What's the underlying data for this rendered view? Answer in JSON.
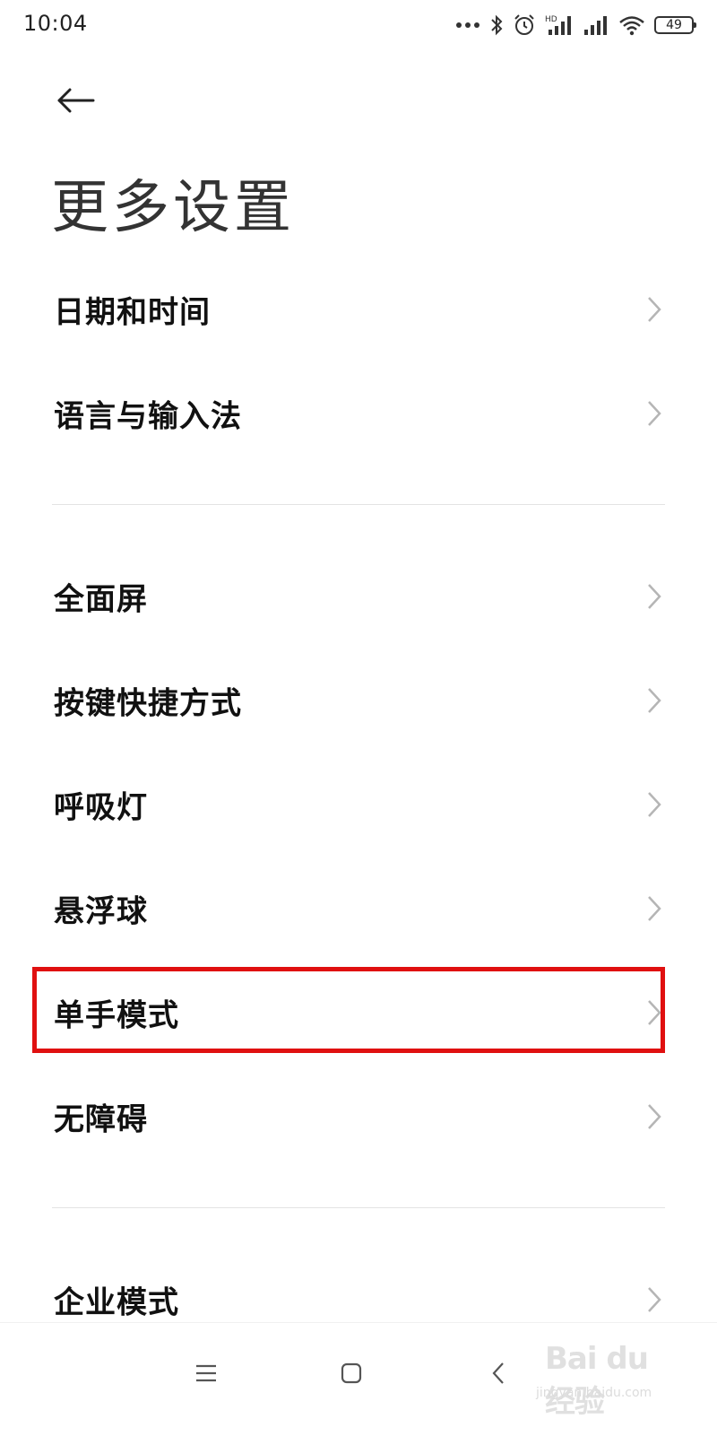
{
  "status_bar": {
    "time": "10:04",
    "battery": "49",
    "icons": [
      "more-dots-icon",
      "bluetooth-icon",
      "alarm-icon",
      "hd-signal-icon",
      "signal-icon",
      "wifi-icon",
      "battery-icon"
    ]
  },
  "header": {
    "back_icon": "back-arrow-icon",
    "title": "更多设置"
  },
  "sections": [
    {
      "items": [
        {
          "label": "日期和时间"
        },
        {
          "label": "语言与输入法"
        }
      ]
    },
    {
      "items": [
        {
          "label": "全面屏"
        },
        {
          "label": "按键快捷方式"
        },
        {
          "label": "呼吸灯"
        },
        {
          "label": "悬浮球"
        },
        {
          "label": "单手模式",
          "highlighted": true
        },
        {
          "label": "无障碍"
        }
      ]
    },
    {
      "items": [
        {
          "label": "企业模式"
        }
      ]
    }
  ],
  "highlight_color": "#e01010",
  "nav_bar": {
    "buttons": [
      "menu-icon",
      "home-icon",
      "back-icon"
    ]
  },
  "watermark": {
    "text": "Bai du 经验",
    "sub": "jingyan.baidu.com"
  }
}
